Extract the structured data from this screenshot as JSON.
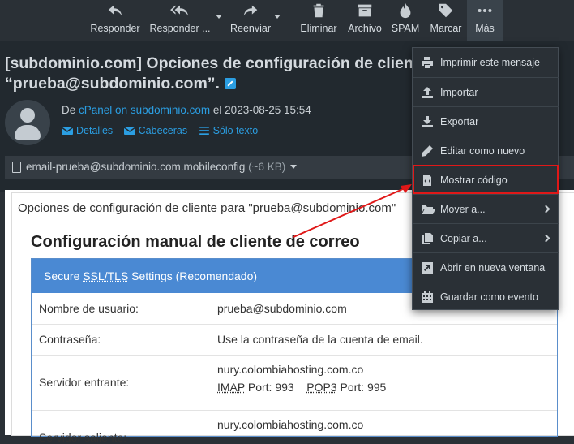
{
  "toolbar": {
    "reply": "Responder",
    "reply_all": "Responder ...",
    "forward": "Reenviar",
    "delete": "Eliminar",
    "archive": "Archivo",
    "spam": "SPAM",
    "mark": "Marcar",
    "more": "Más"
  },
  "message": {
    "subject_line1": "[subdominio.com] Opciones de configuración de client",
    "subject_line2": "“prueba@subdominio.com”.",
    "from_prefix": "De",
    "from_name": "cPanel on subdominio.com",
    "date_prefix": "el",
    "date": "2023-08-25 15:54",
    "details": "Detalles",
    "headers": "Cabeceras",
    "plain_text": "Sólo texto"
  },
  "attachment": {
    "name": "email-prueba@subdominio.com.mobileconfig",
    "size": "(~6 KB)"
  },
  "body": {
    "intro": "Opciones de configuración de cliente para \"prueba@subdominio.com\"",
    "title": "Configuración manual de cliente de correo",
    "card_head_pre": "Secure ",
    "card_head_abbr": "SSL/TLS",
    "card_head_post": " Settings (Recomendado)",
    "rows": [
      {
        "key": "Nombre de usuario:",
        "value": "prueba@subdominio.com"
      },
      {
        "key": "Contraseña:",
        "value": "Use la contraseña de la cuenta de email."
      },
      {
        "key": "Servidor entrante:",
        "value": "nury.colombiahosting.com.co",
        "imap": "IMAP",
        "imap_port": " Port: 993",
        "pop3": "POP3",
        "pop3_port": " Port: 995"
      },
      {
        "key": "Servidor saliente:",
        "value": "nury.colombiahosting.com.co"
      }
    ]
  },
  "more_menu": {
    "items": [
      {
        "label": "Imprimir este mensaje",
        "icon": "print-icon"
      },
      {
        "label": "Importar",
        "icon": "upload-icon"
      },
      {
        "label": "Exportar",
        "icon": "download-icon"
      },
      {
        "label": "Editar como nuevo",
        "icon": "pencil-icon"
      },
      {
        "label": "Mostrar código",
        "icon": "code-file-icon"
      },
      {
        "label": "Mover a...",
        "icon": "folder-open-icon"
      },
      {
        "label": "Copiar a...",
        "icon": "copy-icon"
      },
      {
        "label": "Abrir en nueva ventana",
        "icon": "external-window-icon"
      },
      {
        "label": "Guardar como evento",
        "icon": "calendar-icon"
      }
    ]
  },
  "colors": {
    "accent": "#2b9ee2",
    "highlight": "#e01818",
    "card_head": "#4a89d3"
  }
}
